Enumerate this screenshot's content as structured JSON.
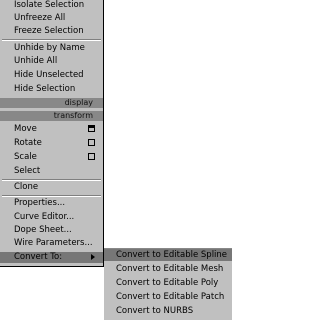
{
  "menu": {
    "items": [
      {
        "label": "Isolate Selection",
        "state": "normal"
      },
      {
        "label": "Unfreeze All",
        "state": "normal"
      },
      {
        "label": "Freeze Selection",
        "state": "normal"
      },
      {
        "label": "Unhide by Name",
        "state": "normal"
      },
      {
        "label": "Unhide All",
        "state": "normal"
      },
      {
        "label": "Hide Unselected",
        "state": "normal"
      },
      {
        "label": "Hide Selection",
        "state": "normal"
      }
    ],
    "display_header": "display",
    "transform_header": "transform",
    "transform_items": [
      {
        "label": "Move",
        "option": true
      },
      {
        "label": "Rotate",
        "option": true
      },
      {
        "label": "Scale",
        "option": true
      },
      {
        "label": "Select",
        "option": false
      }
    ],
    "clone": "Clone",
    "properties": "Properties...",
    "curve_editor": "Curve Editor...",
    "dope_sheet": "Dope Sheet...",
    "wire_parameters": "Wire Parameters...",
    "convert_to": "Convert To:"
  },
  "submenu": {
    "items": [
      "Convert to Editable Spline",
      "Convert to Editable Mesh",
      "Convert to Editable Poly",
      "Convert to Editable Patch",
      "Convert to NURBS"
    ]
  }
}
